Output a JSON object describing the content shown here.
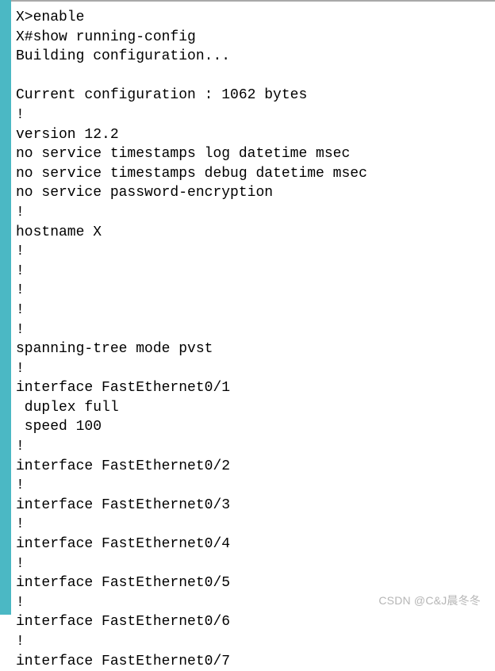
{
  "terminal": {
    "lines": [
      "X>enable",
      "X#show running-config",
      "Building configuration...",
      "",
      "Current configuration : 1062 bytes",
      "!",
      "version 12.2",
      "no service timestamps log datetime msec",
      "no service timestamps debug datetime msec",
      "no service password-encryption",
      "!",
      "hostname X",
      "!",
      "!",
      "!",
      "!",
      "!",
      "spanning-tree mode pvst",
      "!",
      "interface FastEthernet0/1",
      " duplex full",
      " speed 100",
      "!",
      "interface FastEthernet0/2",
      "!",
      "interface FastEthernet0/3",
      "!",
      "interface FastEthernet0/4",
      "!",
      "interface FastEthernet0/5",
      "!",
      "interface FastEthernet0/6",
      "!",
      "interface FastEthernet0/7"
    ]
  },
  "watermark": {
    "text": "CSDN @C&J晨冬冬"
  }
}
